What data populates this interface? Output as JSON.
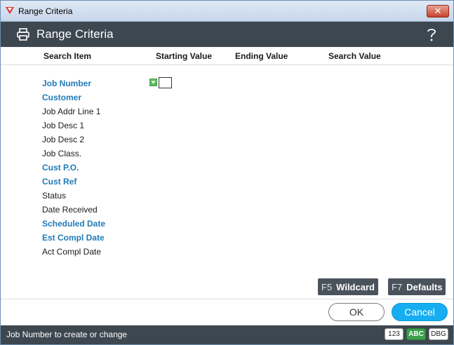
{
  "window": {
    "title": "Range Criteria"
  },
  "header": {
    "title": "Range Criteria"
  },
  "columns": {
    "search_item": "Search Item",
    "starting_value": "Starting Value",
    "ending_value": "Ending Value",
    "search_value": "Search Value"
  },
  "items": [
    {
      "label": "Job Number",
      "required": true
    },
    {
      "label": "Customer",
      "required": true
    },
    {
      "label": "Job Addr Line 1",
      "required": false
    },
    {
      "label": "Job Desc 1",
      "required": false
    },
    {
      "label": "Job Desc 2",
      "required": false
    },
    {
      "label": "Job Class.",
      "required": false
    },
    {
      "label": "Cust P.O.",
      "required": true
    },
    {
      "label": "Cust Ref",
      "required": true
    },
    {
      "label": "Status",
      "required": false
    },
    {
      "label": "Date Received",
      "required": false
    },
    {
      "label": "Scheduled Date",
      "required": true
    },
    {
      "label": "Est Compl Date",
      "required": true
    },
    {
      "label": "Act Compl Date",
      "required": false
    }
  ],
  "fkeys": {
    "wildcard": {
      "key": "F5",
      "label": "Wildcard"
    },
    "defaults": {
      "key": "F7",
      "label": "Defaults"
    }
  },
  "buttons": {
    "ok": "OK",
    "cancel": "Cancel"
  },
  "status": {
    "message": "Job Number to create or change",
    "badge_123": "123",
    "badge_abc": "ABC",
    "badge_dbg": "DBG"
  },
  "colors": {
    "header_bg": "#3d4750",
    "required_label": "#1f7ab8",
    "cancel_button": "#16aef0",
    "abc_badge": "#3aa14a"
  },
  "icons": {
    "app": "app-logo-icon",
    "close": "close-icon",
    "print": "printer-icon",
    "help": "help-icon",
    "dropdown": "dropdown-arrow-icon"
  }
}
